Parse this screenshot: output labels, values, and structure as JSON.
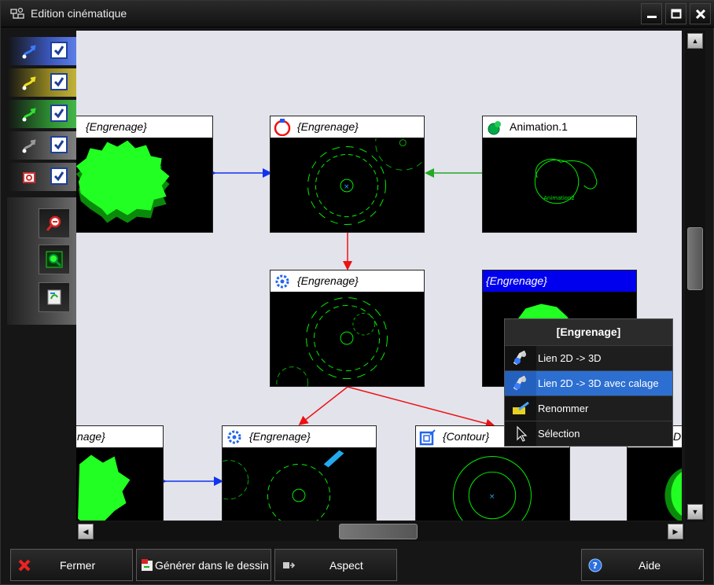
{
  "window": {
    "title": "Edition cinématique",
    "icons": [
      "app-icon",
      "minimize-icon",
      "maximize-icon",
      "close-icon"
    ]
  },
  "left_toolbar": {
    "layer_rows": [
      {
        "icon": "curve-arrow-icon",
        "bg": "#4f6fd6",
        "checked": true
      },
      {
        "icon": "curve-arrow-icon",
        "bg": "#a89a28",
        "checked": true
      },
      {
        "icon": "curve-arrow-icon",
        "bg": "#35a23a",
        "checked": true
      },
      {
        "icon": "curve-arrow-icon",
        "bg": "#7a7a7a",
        "checked": true
      },
      {
        "icon": "component-icon",
        "bg": "#6a6a6a",
        "checked": true
      }
    ],
    "tools": [
      "zoom-icon",
      "zoom-fit-icon",
      "export-icon"
    ]
  },
  "nodes": {
    "n1": {
      "title": "{Engrenage}"
    },
    "n2": {
      "title": "{Engrenage}"
    },
    "n3": {
      "title": "Animation.1",
      "body_text": "Animation2"
    },
    "n4": {
      "title": "{Engrenage}"
    },
    "n5": {
      "title": "{Engrenage}"
    },
    "n6": {
      "title": "nage}"
    },
    "n7": {
      "title": "{Engrenage}"
    },
    "n8": {
      "title": "{Contour}"
    },
    "n9": {
      "title": "D"
    }
  },
  "context_menu": {
    "title": "[Engrenage]",
    "items": [
      {
        "label": "Lien 2D -> 3D",
        "icon": "link-icon"
      },
      {
        "label": "Lien 2D -> 3D avec calage",
        "icon": "link-icon"
      },
      {
        "label": "Renommer",
        "icon": "rename-icon"
      },
      {
        "label": "Sélection",
        "icon": "cursor-icon"
      }
    ],
    "highlighted_index": 1
  },
  "bottom_bar": {
    "close_label": "Fermer",
    "generate_label": "Générer dans le dessin",
    "aspect_label": "Aspect",
    "help_label": "Aide"
  },
  "colors": {
    "canvas_bg": "#e3e3ec",
    "gear_green": "#00ff00",
    "edge_red": "#ee1111",
    "edge_blue": "#1133ee",
    "edge_green": "#22aa22",
    "selection_blue": "#0000ee",
    "menu_highlight": "#2d6fd1"
  }
}
